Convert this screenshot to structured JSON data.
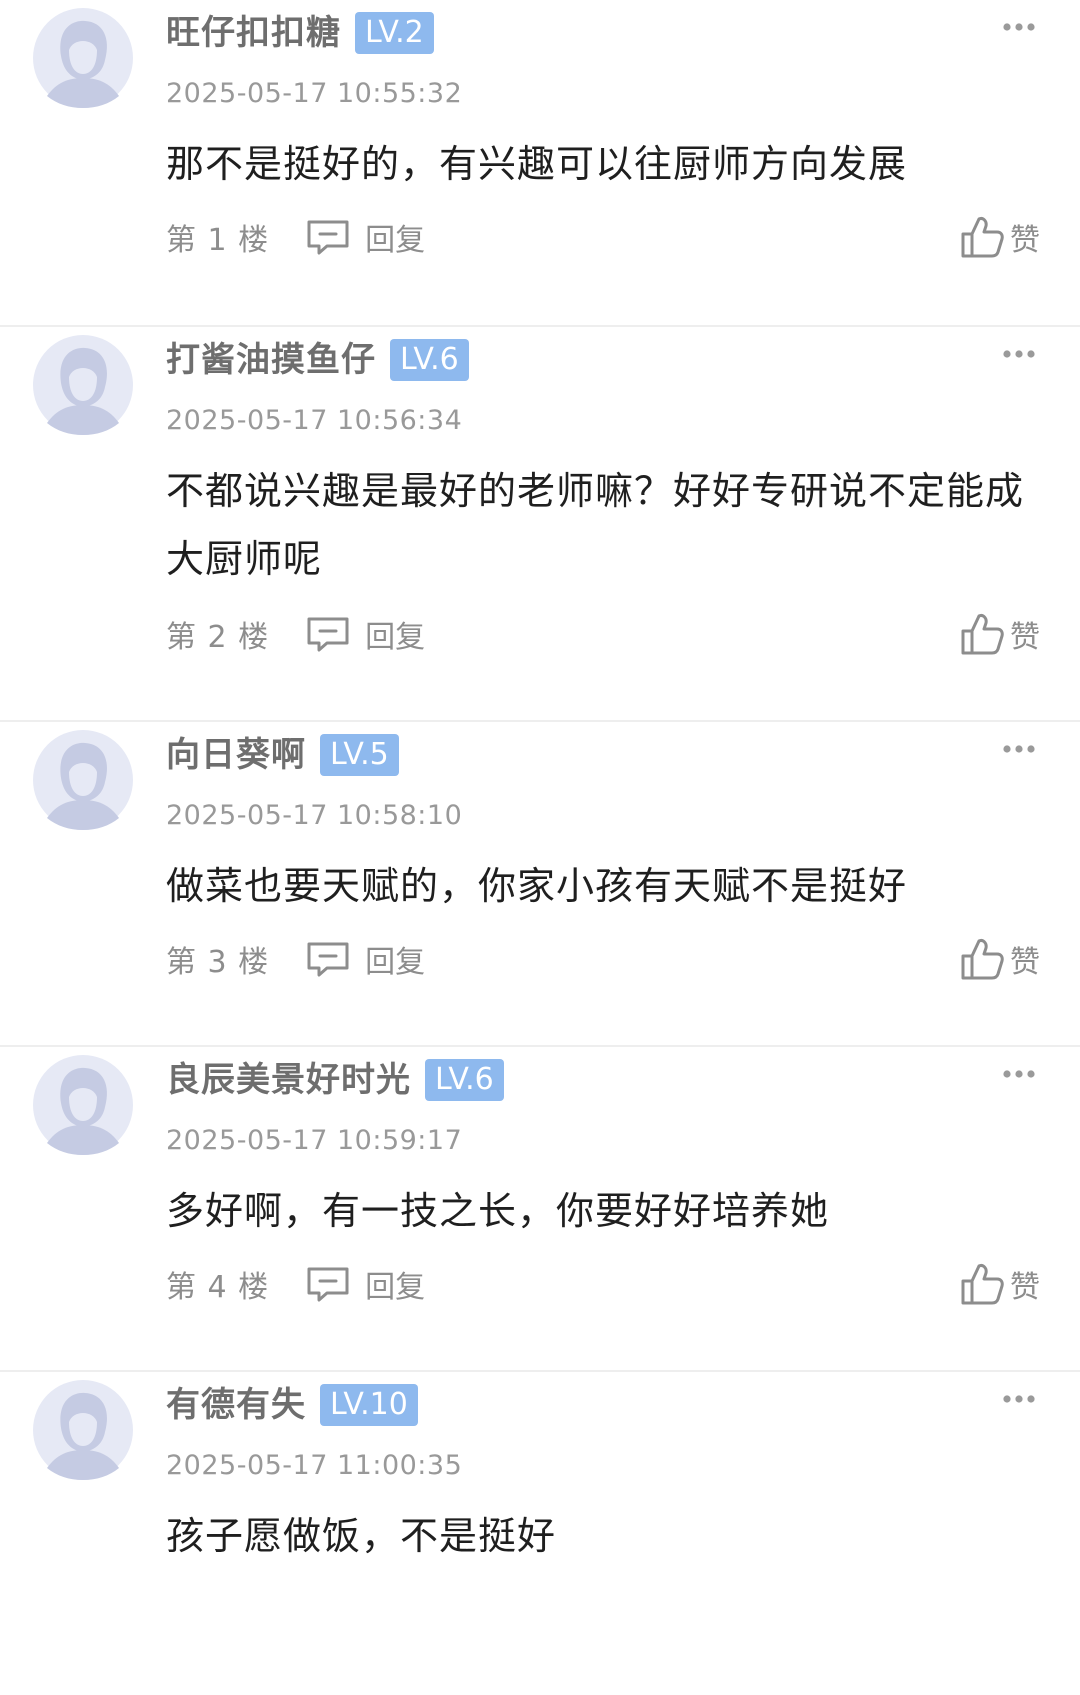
{
  "comments": [
    {
      "username": "旺仔扣扣糖",
      "level": "LV.2",
      "time": "2025-05-17 10:55:32",
      "content": "那不是挺好的，有兴趣可以往厨师方向发展",
      "floor": "第 1 楼",
      "reply_label": "回复",
      "like_label": "赞"
    },
    {
      "username": "打酱油摸鱼仔",
      "level": "LV.6",
      "time": "2025-05-17 10:56:34",
      "content": "不都说兴趣是最好的老师嘛？好好专研说不定能成大厨师呢",
      "floor": "第 2 楼",
      "reply_label": "回复",
      "like_label": "赞"
    },
    {
      "username": "向日葵啊",
      "level": "LV.5",
      "time": "2025-05-17 10:58:10",
      "content": "做菜也要天赋的，你家小孩有天赋不是挺好",
      "floor": "第 3 楼",
      "reply_label": "回复",
      "like_label": "赞"
    },
    {
      "username": "良辰美景好时光",
      "level": "LV.6",
      "time": "2025-05-17 10:59:17",
      "content": "多好啊，有一技之长，你要好好培养她",
      "floor": "第 4 楼",
      "reply_label": "回复",
      "like_label": "赞"
    },
    {
      "username": "有德有失",
      "level": "LV.10",
      "time": "2025-05-17 11:00:35",
      "content": "孩子愿做饭，不是挺好"
    }
  ],
  "colors": {
    "level_badge": "#8eb9ee",
    "avatar_bg": "#e6e9f5",
    "avatar_figure": "#c5cbe3",
    "muted_text": "#8d8d8d"
  }
}
